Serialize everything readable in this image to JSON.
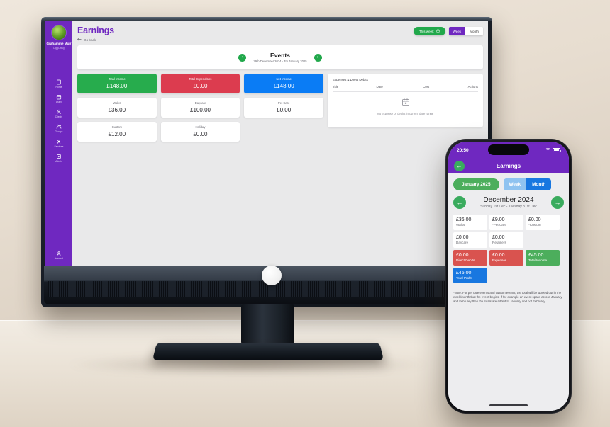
{
  "desktop": {
    "sidebar": {
      "user_name": "Grahamme Muir",
      "user_sub": "DiggDawg",
      "items": [
        {
          "label": "Home",
          "icon": "home-icon"
        },
        {
          "label": "Diary",
          "icon": "diary-icon"
        },
        {
          "label": "Clients",
          "icon": "clients-icon"
        },
        {
          "label": "Groups",
          "icon": "groups-icon"
        },
        {
          "label": "Services",
          "icon": "services-icon"
        },
        {
          "label": "Admin",
          "icon": "admin-icon"
        }
      ],
      "account_label": "Account"
    },
    "header": {
      "page_title": "Earnings",
      "go_back": "Go back",
      "this_week_button": "This week",
      "week_toggle": "Week",
      "month_toggle": "Month"
    },
    "events": {
      "title": "Events",
      "date_range": "29th December 2024 - 4th January 2025",
      "prev": "‹",
      "next": "›"
    },
    "stats": [
      {
        "label": "Total Income",
        "value": "£148.00",
        "style": "green"
      },
      {
        "label": "Total Expenditure",
        "value": "£0.00",
        "style": "red"
      },
      {
        "label": "Net Income",
        "value": "£148.00",
        "style": "blue"
      },
      {
        "label": "Walks",
        "value": "£36.00",
        "style": "white"
      },
      {
        "label": "Daycare",
        "value": "£100.00",
        "style": "white"
      },
      {
        "label": "Pet Care",
        "value": "£0.00",
        "style": "white"
      },
      {
        "label": "Custom",
        "value": "£12.00",
        "style": "white"
      },
      {
        "label": "Holiday",
        "value": "£0.00",
        "style": "white"
      }
    ],
    "expenses": {
      "title": "Expenses & Direct Debits",
      "columns": [
        "Title",
        "Date",
        "Cost",
        "Actions"
      ],
      "empty_message": "No expense or debits in current date range"
    }
  },
  "phone": {
    "status": {
      "time": "20:50"
    },
    "header": {
      "title": "Earnings",
      "back": "←"
    },
    "controls": {
      "month_pill": "January 2025",
      "week_toggle": "Week",
      "month_toggle": "Month"
    },
    "period": {
      "month": "December 2024",
      "range": "Sunday 1st Dec - Tuesday 31st Dec",
      "prev": "←",
      "next": "→"
    },
    "tiles": [
      {
        "value": "£36.00",
        "label": "Walks",
        "style": "white"
      },
      {
        "value": "£9.00",
        "label": "*Pet Care",
        "style": "white"
      },
      {
        "value": "£0.00",
        "label": "*Custom",
        "style": "white"
      },
      {
        "value": "£0.00",
        "label": "Daycare",
        "style": "white"
      },
      {
        "value": "£0.00",
        "label": "Retainers",
        "style": "white"
      },
      {
        "value": "",
        "label": "",
        "style": "empty"
      },
      {
        "value": "£0.00",
        "label": "Direct Debits",
        "style": "red"
      },
      {
        "value": "£0.00",
        "label": "Expenses",
        "style": "red"
      },
      {
        "value": "£45.00",
        "label": "Total Income",
        "style": "green"
      },
      {
        "value": "£45.00",
        "label": "Total Profit",
        "style": "blue"
      }
    ],
    "note": "*Note: For pet care events and custom events, the total will be worked out in the week/month that the event begins. If for example an event spans across January and February then the totals are added to January and not February."
  },
  "colors": {
    "brand_purple": "#6f28c0",
    "green": "#27ac4d",
    "red": "#dc3c4f",
    "blue": "#0a7cf5",
    "phone_blue": "#1877e0"
  }
}
